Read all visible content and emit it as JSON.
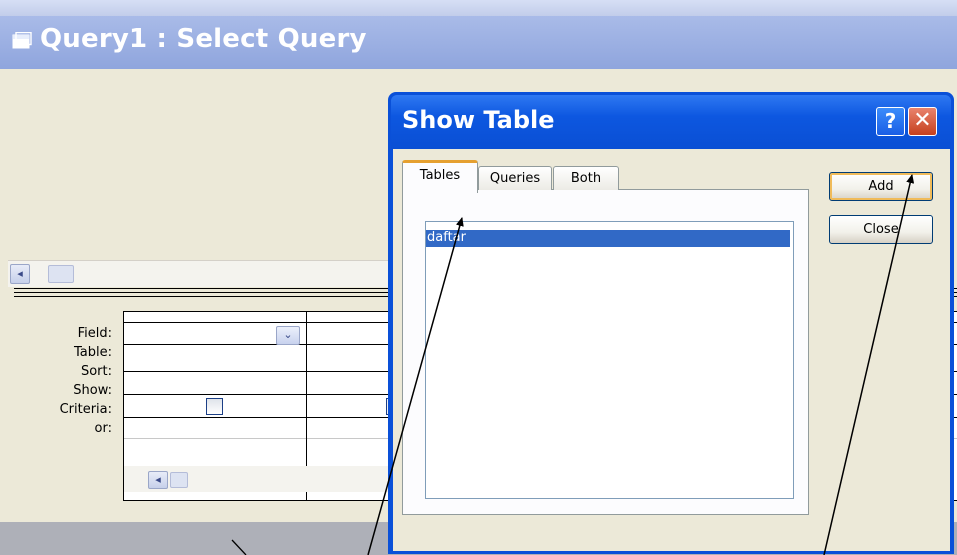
{
  "query_window": {
    "title": "Query1 : Select Query",
    "row_labels": [
      "Field:",
      "Table:",
      "Sort:",
      "Show:",
      "Criteria:",
      "or:"
    ]
  },
  "show_table_dialog": {
    "title": "Show Table",
    "help_label": "?",
    "close_x_label": "✕",
    "tabs": [
      "Tables",
      "Queries",
      "Both"
    ],
    "selected_tab": "Tables",
    "list_items": [
      "daftar"
    ],
    "buttons": {
      "add": "Add",
      "close": "Close"
    }
  },
  "icons": {
    "window_icon": "query-window-icon",
    "scroll_left": "◂",
    "dropdown": "⌄"
  }
}
